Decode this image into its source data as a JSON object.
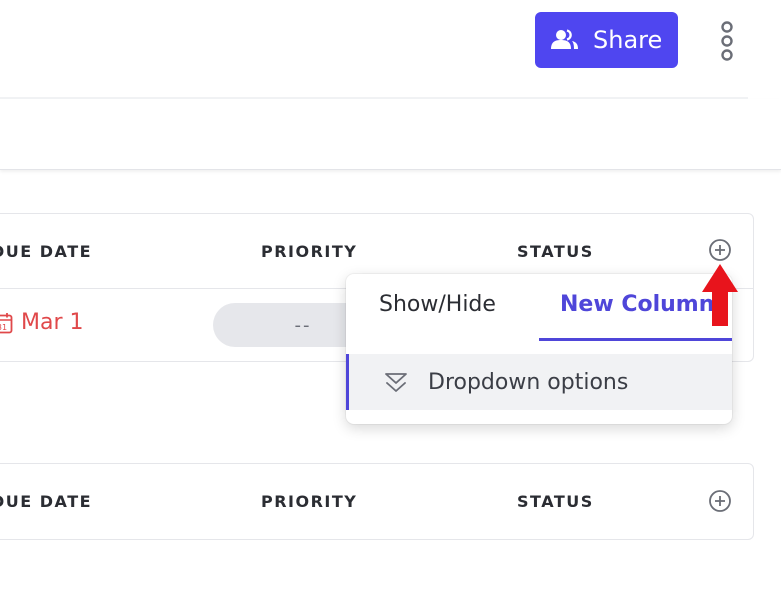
{
  "header": {
    "share_label": "Share",
    "share_icon": "users-icon",
    "more_icon": "vertical-dots-icon",
    "accent_color": "#4f46f0"
  },
  "table_1": {
    "columns": {
      "due_date": "DUE DATE",
      "priority": "PRIORITY",
      "status": "STATUS"
    },
    "add_column_icon": "plus-circle-icon",
    "rows": [
      {
        "due_date": "Mar 1",
        "due_date_icon": "calendar-icon",
        "priority": "--"
      }
    ],
    "due_date_color": "#e0484a"
  },
  "table_2": {
    "columns": {
      "due_date": "DUE DATE",
      "priority": "PRIORITY",
      "status": "STATUS"
    },
    "add_column_icon": "plus-circle-icon"
  },
  "popover": {
    "tabs": [
      {
        "label": "Show/Hide",
        "active": false
      },
      {
        "label": "New Column",
        "active": true
      }
    ],
    "options": [
      {
        "label": "Dropdown options",
        "icon": "dropdown-chevrons-icon"
      }
    ],
    "active_color": "#4f46d9"
  },
  "annotation": {
    "arrow_color": "#e8141c",
    "arrow_icon": "red-up-arrow-icon"
  }
}
